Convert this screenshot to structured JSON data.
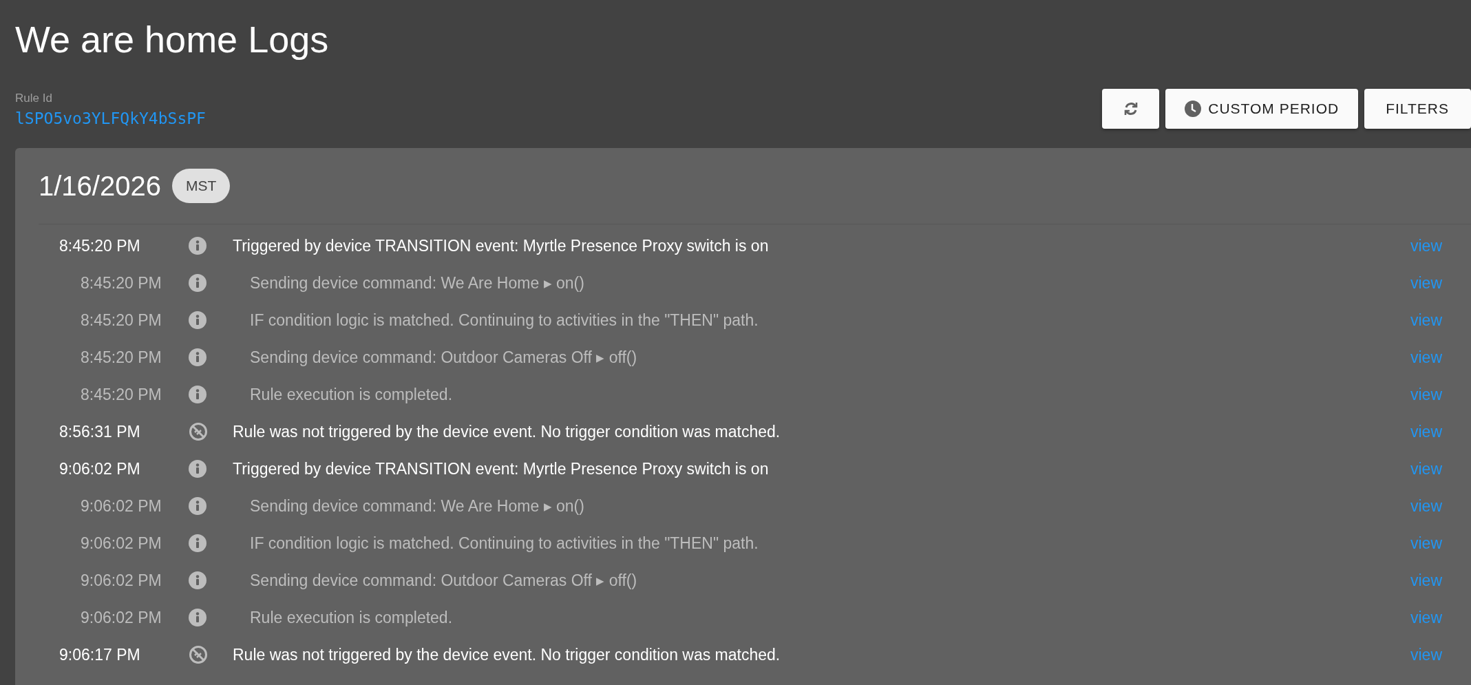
{
  "title": "We are home Logs",
  "rule_id": {
    "label": "Rule Id",
    "value": "lSPO5vo3YLFQkY4bSsPF"
  },
  "toolbar": [
    {
      "kind": "refresh"
    },
    {
      "kind": "period",
      "label": "CUSTOM PERIOD"
    },
    {
      "kind": "plain",
      "label": "FILTERS"
    }
  ],
  "day": {
    "date": "1/16/2026",
    "timezone": "MST",
    "entries": [
      {
        "time": "8:45:20 PM",
        "kind": "info",
        "message": "Triggered by device TRANSITION event: Myrtle Presence Proxy switch is on",
        "link": "view",
        "children": [
          {
            "time": "8:45:20 PM",
            "kind": "info",
            "message": "Sending device command: We Are Home ▸ on()",
            "link": "view"
          },
          {
            "time": "8:45:20 PM",
            "kind": "info",
            "message": "IF condition logic is matched. Continuing to activities in the \"THEN\" path.",
            "link": "view"
          },
          {
            "time": "8:45:20 PM",
            "kind": "info",
            "message": "Sending device command: Outdoor Cameras Off ▸ off()",
            "link": "view"
          },
          {
            "time": "8:45:20 PM",
            "kind": "info",
            "message": "Rule execution is completed.",
            "link": "view"
          }
        ]
      },
      {
        "time": "8:56:31 PM",
        "kind": "not-triggered",
        "message": "Rule was not triggered by the device event. No trigger condition was matched.",
        "link": "view"
      },
      {
        "time": "9:06:02 PM",
        "kind": "info",
        "message": "Triggered by device TRANSITION event: Myrtle Presence Proxy switch is on",
        "link": "view",
        "children": [
          {
            "time": "9:06:02 PM",
            "kind": "info",
            "message": "Sending device command: We Are Home ▸ on()",
            "link": "view"
          },
          {
            "time": "9:06:02 PM",
            "kind": "info",
            "message": "IF condition logic is matched. Continuing to activities in the \"THEN\" path.",
            "link": "view"
          },
          {
            "time": "9:06:02 PM",
            "kind": "info",
            "message": "Sending device command: Outdoor Cameras Off ▸ off()",
            "link": "view"
          },
          {
            "time": "9:06:02 PM",
            "kind": "info",
            "message": "Rule execution is completed.",
            "link": "view"
          }
        ]
      },
      {
        "time": "9:06:17 PM",
        "kind": "not-triggered",
        "message": "Rule was not triggered by the device event. No trigger condition was matched.",
        "link": "view"
      }
    ]
  }
}
